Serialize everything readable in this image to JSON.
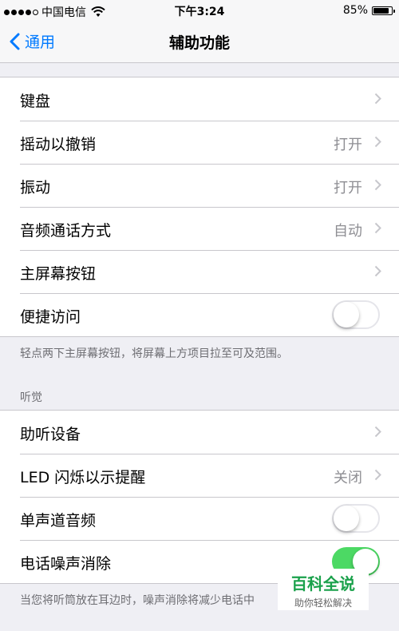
{
  "status": {
    "carrier": "中国电信",
    "time": "下午3:24",
    "battery": "85%",
    "battery_level": 0.85
  },
  "nav": {
    "back_label": "通用",
    "title": "辅助功能"
  },
  "group1": {
    "rows": [
      {
        "label": "键盘",
        "value": ""
      },
      {
        "label": "摇动以撤销",
        "value": "打开"
      },
      {
        "label": "振动",
        "value": "打开"
      },
      {
        "label": "音频通话方式",
        "value": "自动"
      },
      {
        "label": "主屏幕按钮",
        "value": ""
      },
      {
        "label": "便捷访问",
        "toggle": false
      }
    ],
    "footer": "轻点两下主屏幕按钮，将屏幕上方项目拉至可及范围。"
  },
  "hearing": {
    "header": "听觉",
    "rows": [
      {
        "label": "助听设备",
        "value": ""
      },
      {
        "label": "LED 闪烁以示提醒",
        "value": "关闭"
      },
      {
        "label": "单声道音频",
        "toggle": false
      },
      {
        "label": "电话噪声消除",
        "toggle": true
      }
    ],
    "footer": "当您将听筒放在耳边时，噪声消除将减少电话中"
  },
  "watermark": {
    "title": "百科全说",
    "subtitle": "助你轻松解决"
  },
  "colors": {
    "accent": "#007aff",
    "toggle_on": "#4cd964",
    "background": "#efeff4"
  }
}
